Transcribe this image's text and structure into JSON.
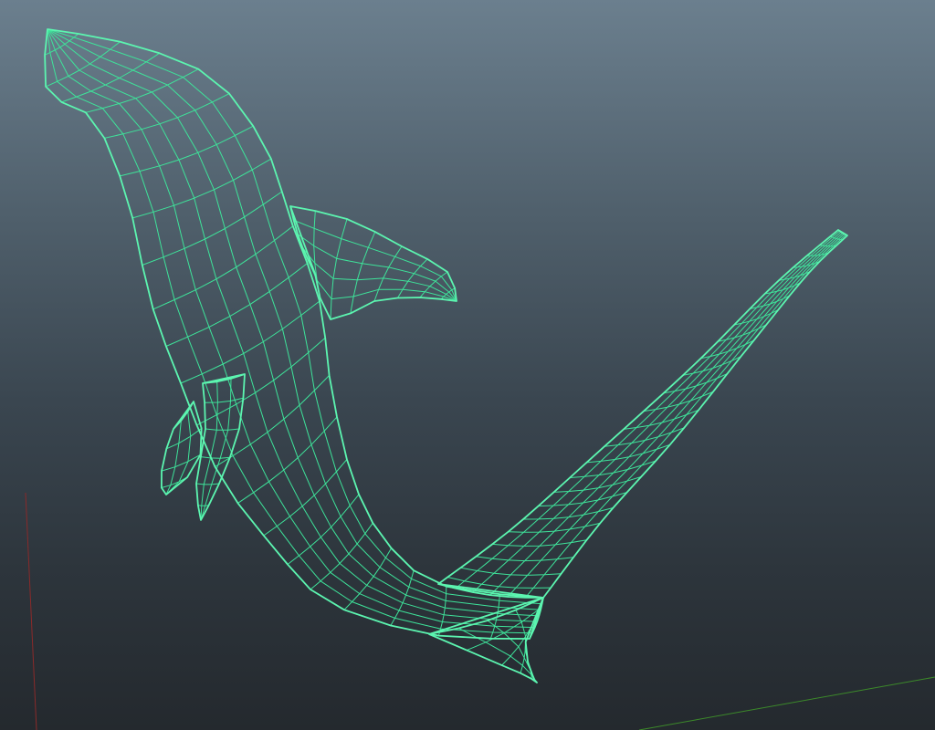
{
  "viewport": {
    "background_top": "#6b7f8e",
    "background_bottom": "#24292e"
  },
  "scene": {
    "object": "wireframe-mesh",
    "wire_color": "#3ee39a",
    "outline_color": "#5cf5b0",
    "axis_x_color": "#3c8a2a",
    "axis_y_color": "#8a2a2a"
  }
}
